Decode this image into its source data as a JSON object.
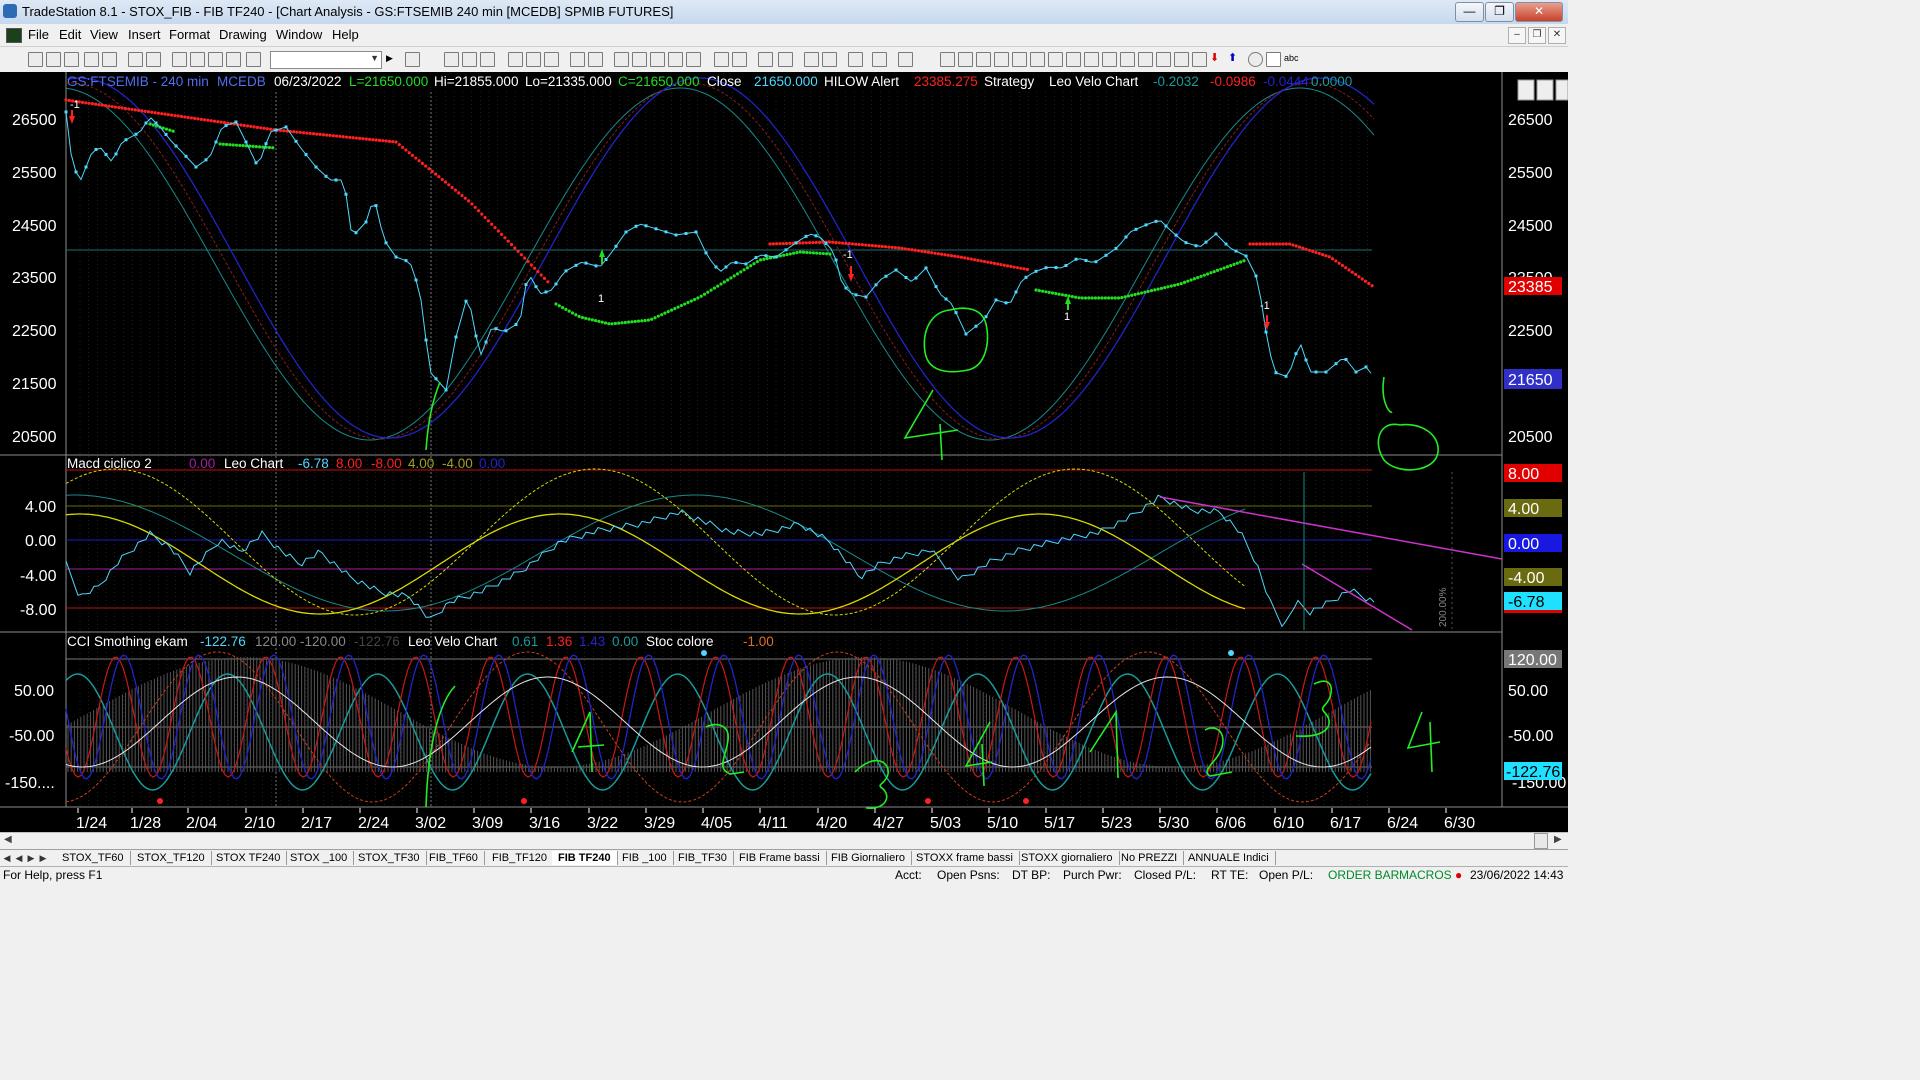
{
  "window": {
    "title": "TradeStation 8.1 - STOX_FIB - FIB TF240 - [Chart Analysis - GS:FTSEMIB  240 min  [MCEDB] SPMIB FUTURES]",
    "minimize": "—",
    "restore": "❐",
    "close": "✕"
  },
  "menu": [
    "File",
    "Edit",
    "View",
    "Insert",
    "Format",
    "Drawing",
    "Window",
    "Help"
  ],
  "price_panel": {
    "header": {
      "symbol": "GS:FTSEMIB - 240 min",
      "feed": "MCEDB",
      "date": "06/23/2022",
      "last": "L=21650.000",
      "hi": "Hi=21855.000",
      "lo": "Lo=21335.000",
      "close_c": "C=21650.000",
      "close_label": "Close",
      "close_val": "21650.000",
      "hilow": "HILOW Alert",
      "hilow_val": "23385.275",
      "strategy": "Strategy",
      "velo": "Leo Velo Chart",
      "v1": "-0.2032",
      "v2": "-0.0986",
      "v3": "-0.0444",
      "v4": "0.0000"
    },
    "y_ticks": [
      "26500",
      "25500",
      "24500",
      "23500",
      "22500",
      "21500",
      "20500"
    ],
    "tag_red": "23385",
    "tag_last": "21650",
    "strategy_marks": [
      "-1",
      "1",
      "-1",
      "1",
      "-1"
    ]
  },
  "macd_panel": {
    "header": {
      "name": "Macd ciclico 2",
      "v0": "0.00",
      "leo": "Leo Chart",
      "c1": "-6.78",
      "c2": "8.00",
      "c3": "-8.00",
      "c4": "4.00",
      "c5": "-4.00",
      "c6": "0.00"
    },
    "y_ticks": [
      "4.00",
      "0.00",
      "-4.00",
      "-8.00"
    ],
    "tags": {
      "t8": "8.00",
      "t4": "4.00",
      "t0": "0.00",
      "tm4": "-4.00",
      "tval": "-6.78",
      "tm8": "-8.00"
    },
    "note": "200.00%"
  },
  "cci_panel": {
    "header": {
      "name": "CCI Smothing ekam",
      "v1": "-122.76",
      "v2": "120.00",
      "v3": "-120.00",
      "v4": "-122.76",
      "velo": "Leo Velo Chart",
      "w1": "0.61",
      "w2": "1.36",
      "w3": "1.43",
      "w4": "0.00",
      "stoc": "Stoc colore",
      "stoc_val": "-1.00"
    },
    "y_ticks": [
      "50.00",
      "-50.00",
      "-150...."
    ],
    "tags": {
      "t120": "120.00",
      "t50": "50.00",
      "tm50": "-50.00",
      "tval": "-122.76",
      "tm150": "-150.00"
    }
  },
  "x_axis": [
    "1/24",
    "1/28",
    "2/04",
    "2/10",
    "2/17",
    "2/24",
    "3/02",
    "3/09",
    "3/16",
    "3/22",
    "3/29",
    "4/05",
    "4/11",
    "4/20",
    "4/27",
    "5/03",
    "5/10",
    "5/17",
    "5/23",
    "5/30",
    "6/06",
    "6/10",
    "6/17",
    "6/24",
    "6/30"
  ],
  "tabs": [
    "STOX_TF60",
    "STOX_TF120",
    "STOX TF240",
    "STOX _100",
    "STOX_TF30",
    "FIB_TF60",
    "FIB_TF120",
    "FIB TF240",
    "FIB _100",
    "FIB_TF30",
    "FIB Frame bassi",
    "FIB Giornaliero",
    "STOXX frame bassi",
    "STOXX giornaliero",
    "No PREZZI",
    "ANNUALE Indici"
  ],
  "active_tab": "FIB TF240",
  "status": {
    "help": "For Help, press F1",
    "acct": "Acct:",
    "open_psns": "Open Psns:",
    "dt_bp": "DT BP:",
    "purch_pwr": "Purch Pwr:",
    "closed_pl": "Closed P/L:",
    "rt_te": "RT TE:",
    "open_pl": "Open P/L:",
    "order_bar": "ORDER BAR",
    "macros": "MACROS",
    "datetime": "23/06/2022 14:43"
  },
  "colors": {
    "background": "#000000",
    "price_line": "#4ed8ff",
    "hilow_red": "#ff2020",
    "hilow_green": "#22dd22",
    "sine_blue": "#2323c8",
    "sine_teal": "#1a8a8a",
    "sine_darkred": "#8a1a1a",
    "macd_yellow": "#d8d800",
    "trend_magenta": "#cc33cc",
    "handwriting": "#00ff00"
  }
}
